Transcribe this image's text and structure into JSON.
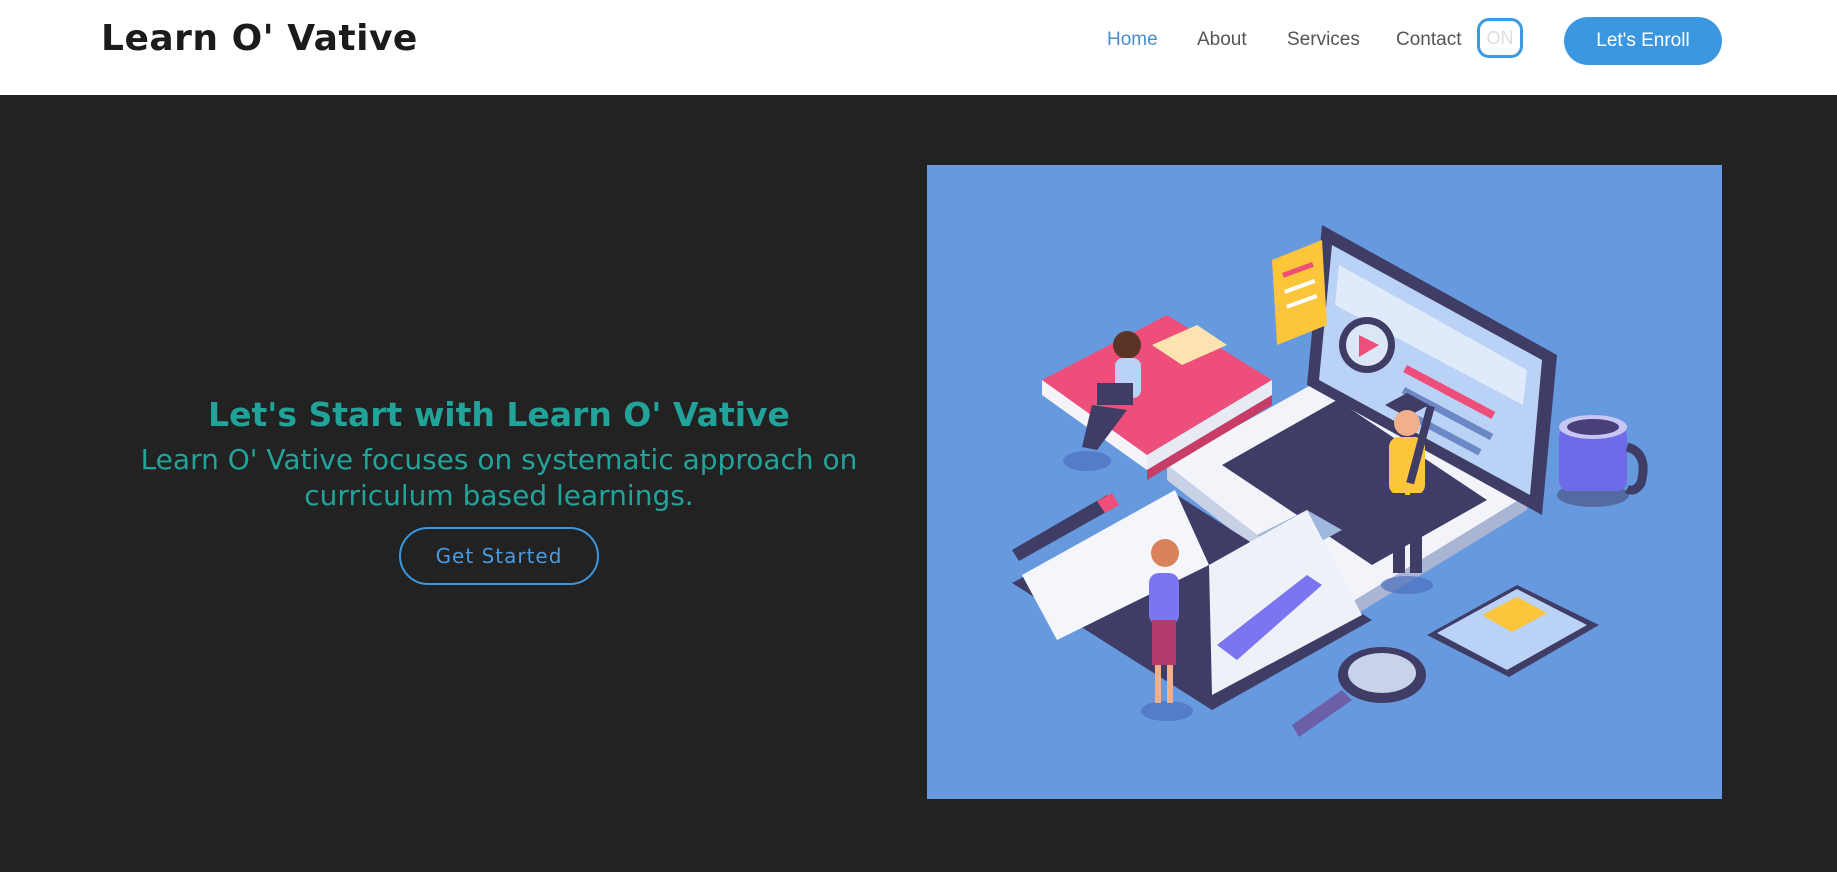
{
  "navbar": {
    "brand": "Learn O' Vative",
    "links": [
      {
        "label": "Home",
        "active": true
      },
      {
        "label": "About",
        "active": false
      },
      {
        "label": "Services",
        "active": false
      },
      {
        "label": "Contact",
        "active": false
      }
    ],
    "toggle_label": "ON",
    "enroll_label": "Let's Enroll"
  },
  "hero": {
    "title": "Let's Start with Learn O' Vative",
    "subtitle": "Learn O' Vative focuses on systematic approach on curriculum based learnings.",
    "cta_label": "Get Started"
  },
  "colors": {
    "accent": "#3b98e0",
    "heading_teal": "#22a39a",
    "background_dark": "#222222",
    "illustration_bg": "#6699dd"
  }
}
